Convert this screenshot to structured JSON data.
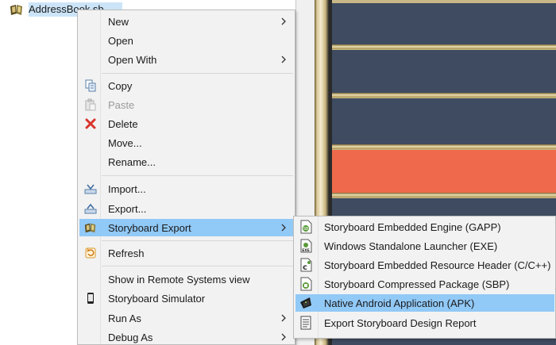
{
  "tree": {
    "item_label": "AddressBook.sb"
  },
  "context_menu": {
    "items": [
      {
        "label": "New",
        "submenu": true
      },
      {
        "label": "Open"
      },
      {
        "label": "Open With",
        "submenu": true
      },
      {
        "label": "Copy",
        "icon": "copy-icon"
      },
      {
        "label": "Paste",
        "icon": "paste-icon",
        "disabled": true
      },
      {
        "label": "Delete",
        "icon": "delete-icon"
      },
      {
        "label": "Move..."
      },
      {
        "label": "Rename..."
      },
      {
        "label": "Import...",
        "icon": "import-icon"
      },
      {
        "label": "Export...",
        "icon": "export-icon"
      },
      {
        "label": "Storyboard Export",
        "icon": "storyboard-icon",
        "submenu": true,
        "active": true
      },
      {
        "label": "Refresh",
        "icon": "refresh-icon"
      },
      {
        "label": "Show in Remote Systems view"
      },
      {
        "label": "Storyboard Simulator",
        "icon": "simulator-icon"
      },
      {
        "label": "Run As",
        "submenu": true
      },
      {
        "label": "Debug As",
        "submenu": true
      }
    ]
  },
  "submenu": {
    "items": [
      {
        "label": "Storyboard Embedded Engine (GAPP)",
        "icon": "gapp-file-icon"
      },
      {
        "label": "Windows Standalone Launcher (EXE)",
        "icon": "exe-file-icon"
      },
      {
        "label": "Storyboard Embedded Resource Header (C/C++)",
        "icon": "c-header-file-icon"
      },
      {
        "label": "Storyboard Compressed Package (SBP)",
        "icon": "sbp-file-icon"
      },
      {
        "label": "Native Android Application (APK)",
        "icon": "android-icon",
        "active": true
      },
      {
        "label": "Export Storyboard Design Report",
        "icon": "report-icon"
      }
    ]
  },
  "colors": {
    "menu_bg": "#f2f2f2",
    "highlight": "#91c9f7",
    "tree_selection": "#cce4f7",
    "preview_band": "#3e4b60",
    "preview_accent": "#ef6a4c"
  }
}
